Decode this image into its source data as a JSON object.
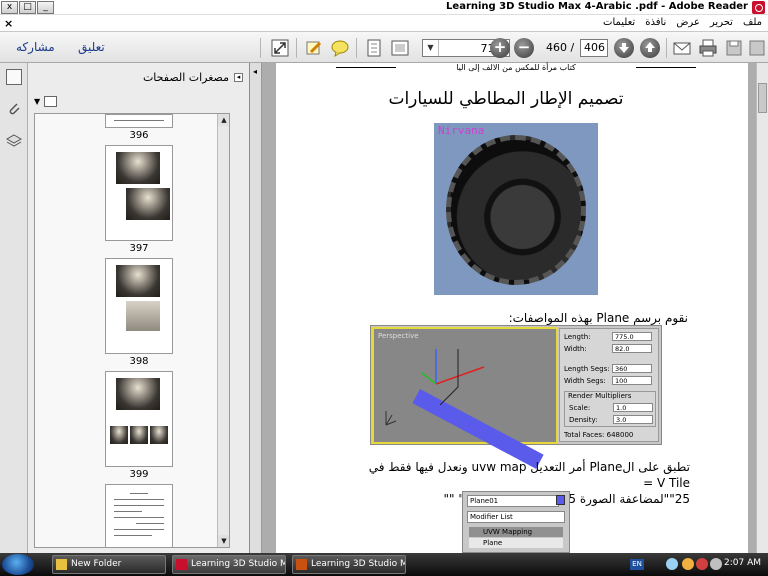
{
  "window": {
    "title": "Learning 3D Studio Max 4-Arabic .pdf - Adobe Reader",
    "controls": [
      "x",
      "□",
      "_"
    ]
  },
  "menubar": {
    "items": [
      "ملف",
      "تحرير",
      "عرض",
      "نافذة",
      "تعليمات"
    ],
    "close_symbol": "×"
  },
  "toolbar": {
    "share_label": "مشاركه",
    "comment_label": "تعليق",
    "zoom_value": "71%",
    "zoom_out_symbol": "−",
    "zoom_in_symbol": "+",
    "page_current": "406",
    "page_total": "460 /"
  },
  "panel": {
    "title": "مصغرات الصفحات",
    "thumbnail_labels": [
      "396",
      "397",
      "398",
      "399"
    ]
  },
  "document": {
    "header": "كتاب مرأة للمكس من الالف إلى اليا",
    "heading": "تصميم الإطار المطاطي للسيارات",
    "tire_watermark": "Nirvana",
    "paragraph1": "نقوم برسم Plane بهذه المواصفات:",
    "viewport_label": "Perspective",
    "params": [
      {
        "label": "Length:",
        "value": "775.0"
      },
      {
        "label": "Width:",
        "value": "82.0"
      },
      {
        "label": "Length Segs:",
        "value": "360"
      },
      {
        "label": "Width Segs:",
        "value": "100"
      }
    ],
    "render_multipliers_label": "Render Multipliers",
    "render_params": [
      {
        "label": "Scale:",
        "value": "1.0"
      },
      {
        "label": "Density:",
        "value": "3.0"
      }
    ],
    "total_faces": "Total Faces: 648000",
    "paragraph2_line1": "تطبق على الPlane أمر التعديل uvw map ونعدل فيها فقط في V Tile =",
    "paragraph2_line2": "25\"\"لمضاعفة الصورة 25 مرة على الPlane\" \"\"",
    "modifier_object": "Plane01",
    "modifier_list": "Modifier List",
    "modifier_stack": [
      "UVW Mapping",
      "Plane"
    ]
  },
  "taskbar": {
    "tasks": [
      "New Folder",
      "Learning 3D Studio Ma...",
      "Learning 3D Studio Ma..."
    ],
    "language": "EN",
    "clock": "2:07 AM"
  }
}
